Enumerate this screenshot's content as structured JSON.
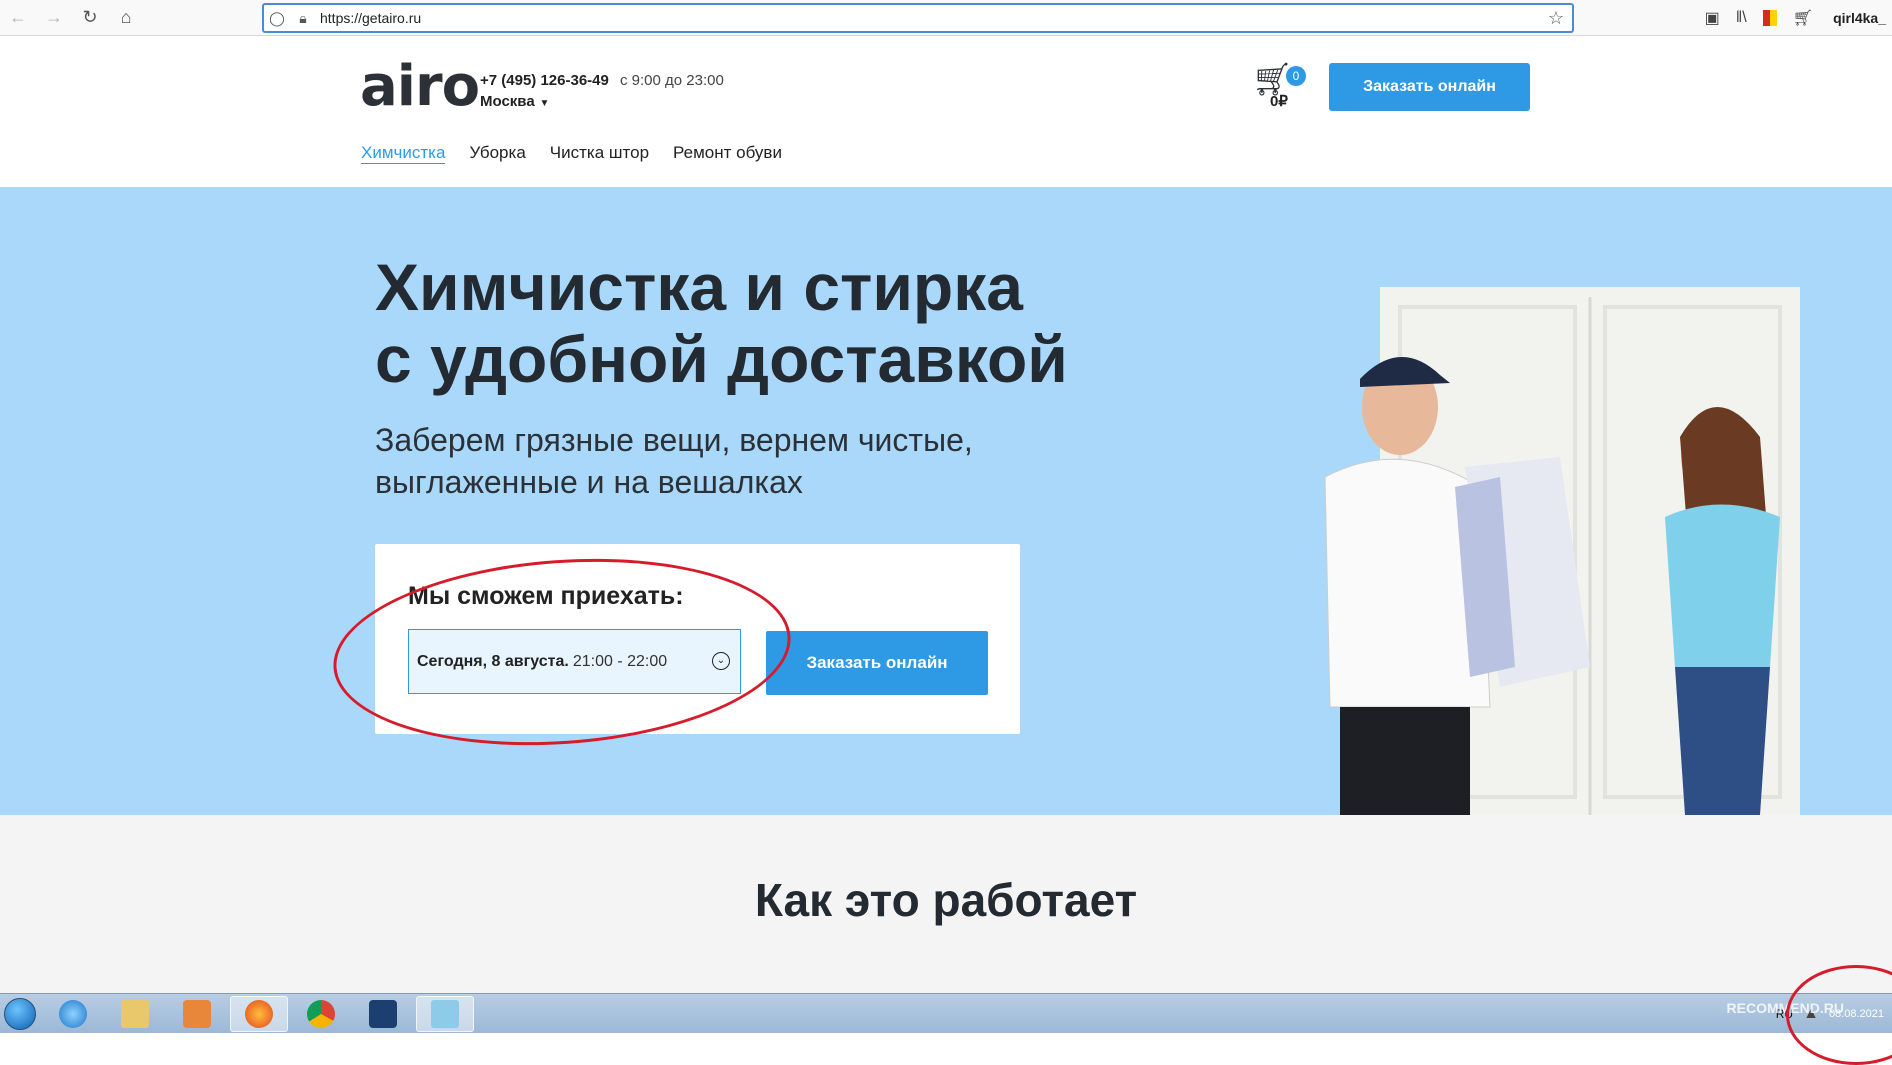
{
  "browser": {
    "url": "https://getairo.ru",
    "user": "qirl4ka_",
    "icons": [
      "back-icon",
      "forward-icon",
      "reload-icon",
      "home-icon",
      "shield-icon",
      "lock-icon",
      "bookmark-star-icon",
      "pocket-icon",
      "library-icon",
      "cart-icon"
    ]
  },
  "header": {
    "logo": "airo",
    "phone": "+7 (495) 126-36-49",
    "hours": "с 9:00 до 23:00",
    "city": "Москва",
    "cart_count": "0",
    "cart_sum": "0₽",
    "order_button": "Заказать онлайн"
  },
  "nav": {
    "items": [
      {
        "label": "Химчистка",
        "active": true
      },
      {
        "label": "Уборка"
      },
      {
        "label": "Чистка штор"
      },
      {
        "label": "Ремонт обуви"
      }
    ]
  },
  "hero": {
    "title": "Химчистка и стирка\nс удобной доставкой",
    "subtitle": "Заберем грязные вещи, вернем чистые,\nвыглаженные и на вешалках",
    "booking_label": "Мы сможем приехать:",
    "date": "Сегодня, 8 августа.",
    "time": "21:00 - 22:00",
    "order_button": "Заказать онлайн"
  },
  "how_it_works": {
    "title": "Как это работает"
  },
  "taskbar": {
    "lang": "RU",
    "date": "08.08.2021",
    "watermark": "RECOMMEND.RU"
  },
  "colors": {
    "accent": "#2e9ae6",
    "hero_bg": "#a9d8fa",
    "annotation": "#d61c2b"
  }
}
